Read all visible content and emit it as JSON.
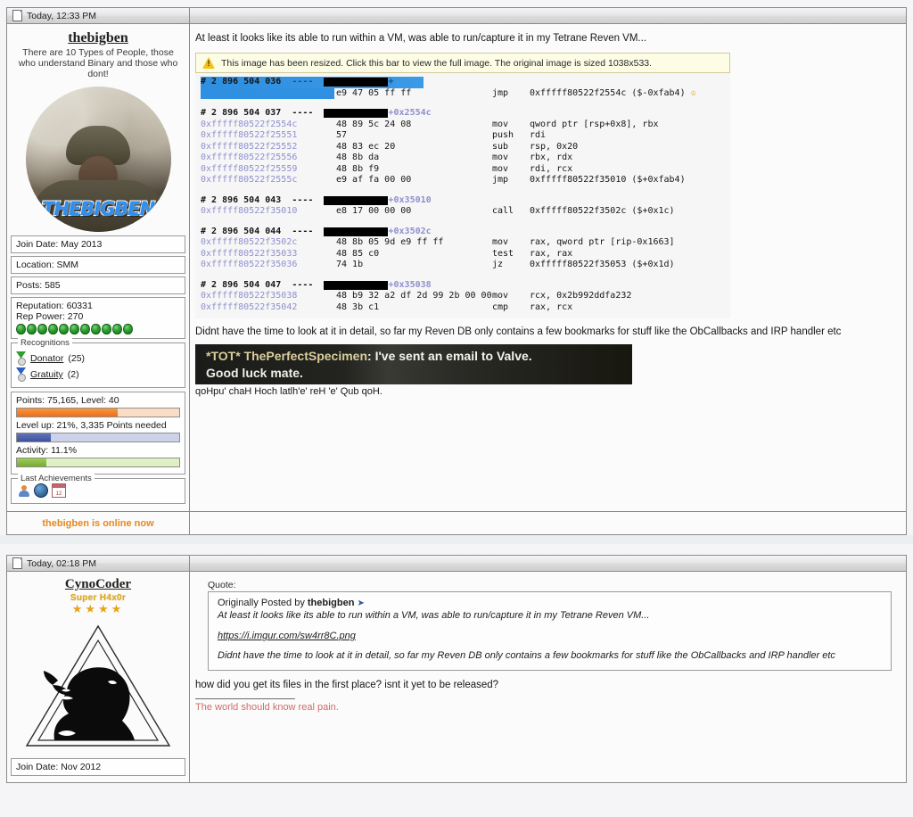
{
  "posts": [
    {
      "header": {
        "timestamp": "Today, 12:33 PM",
        "icon": "document-icon"
      },
      "user": {
        "name": "thebigben",
        "title": "There are 10 Types of People, those who understand Binary and those who dont!",
        "avatar_text": "THEBIGBEN",
        "join_date": "Join Date: May 2013",
        "location": "Location: SMM",
        "posts": "Posts: 585",
        "reputation": "Reputation: 60331",
        "rep_power": "Rep Power: 270",
        "rep_pips": 11,
        "recognitions_legend": "Recognitions",
        "recognitions": [
          {
            "label": "Donator",
            "count": "(25)",
            "color": "#2e9e2e"
          },
          {
            "label": "Gratuity",
            "count": "(2)",
            "color": "#2f5fc0"
          }
        ],
        "points": "Points: 75,165, Level: 40",
        "points_pct": 62,
        "levelup": "Level up: 21%, 3,335 Points needed",
        "levelup_pct": 21,
        "activity": "Activity: 11.1%",
        "activity_pct": 18,
        "achievements_legend": "Last Achievements",
        "achievement_icons": [
          "person-icon",
          "globe-icon",
          "calendar-icon"
        ],
        "online_status": "thebigben is online now"
      },
      "content": {
        "intro": "At least it looks like its able to run within a VM, was able to run/capture it in my Tetrane Reven VM...",
        "resize_notice": "This image has been resized. Click this bar to view the full image. The original image is sized 1038x533.",
        "outro": "Didnt have the time to look at it in detail, so far my Reven DB only contains a few bookmarks for stuff like the ObCallbacks and IRP handler etc",
        "video": {
          "nickname": "*TOT* ThePerfectSpecimen",
          "line1": ": I've sent an email to Valve.",
          "line2": "Good luck mate."
        },
        "klingon": "qoHpu' chaH Hoch latlh'e' reH 'e' Qub qoH."
      },
      "disassembly": [
        {
          "type": "group",
          "id": "# 2 896 504 036",
          "dashes": "----",
          "offset": "",
          "selected": true
        },
        {
          "type": "code",
          "addr": "",
          "bytes": "e9 47 05 ff ff",
          "mnemonic": "jmp",
          "operands": "0xfffff80522f2554c ($-0xfab4)",
          "crown": true
        },
        {
          "type": "blank"
        },
        {
          "type": "group",
          "id": "# 2 896 504 037",
          "dashes": "----",
          "offset": "+0x2554c"
        },
        {
          "type": "code",
          "addr": "0xfffff80522f2554c",
          "bytes": "48 89 5c 24 08",
          "mnemonic": "mov",
          "operands": "qword ptr [rsp+0x8], rbx"
        },
        {
          "type": "code",
          "addr": "0xfffff80522f25551",
          "bytes": "57",
          "mnemonic": "push",
          "operands": "rdi"
        },
        {
          "type": "code",
          "addr": "0xfffff80522f25552",
          "bytes": "48 83 ec 20",
          "mnemonic": "sub",
          "operands": "rsp, 0x20"
        },
        {
          "type": "code",
          "addr": "0xfffff80522f25556",
          "bytes": "48 8b da",
          "mnemonic": "mov",
          "operands": "rbx, rdx"
        },
        {
          "type": "code",
          "addr": "0xfffff80522f25559",
          "bytes": "48 8b f9",
          "mnemonic": "mov",
          "operands": "rdi, rcx"
        },
        {
          "type": "code",
          "addr": "0xfffff80522f2555c",
          "bytes": "e9 af fa 00 00",
          "mnemonic": "jmp",
          "operands": "0xfffff80522f35010 ($+0xfab4)"
        },
        {
          "type": "blank"
        },
        {
          "type": "group",
          "id": "# 2 896 504 043",
          "dashes": "----",
          "offset": "+0x35010"
        },
        {
          "type": "code",
          "addr": "0xfffff80522f35010",
          "bytes": "e8 17 00 00 00",
          "mnemonic": "call",
          "operands": "0xfffff80522f3502c ($+0x1c)"
        },
        {
          "type": "blank"
        },
        {
          "type": "group",
          "id": "# 2 896 504 044",
          "dashes": "----",
          "offset": "+0x3502c"
        },
        {
          "type": "code",
          "addr": "0xfffff80522f3502c",
          "bytes": "48 8b 05 9d e9 ff ff",
          "mnemonic": "mov",
          "operands": "rax, qword ptr [rip-0x1663]"
        },
        {
          "type": "code",
          "addr": "0xfffff80522f35033",
          "bytes": "48 85 c0",
          "mnemonic": "test",
          "operands": "rax, rax"
        },
        {
          "type": "code",
          "addr": "0xfffff80522f35036",
          "bytes": "74 1b",
          "mnemonic": "jz",
          "operands": "0xfffff80522f35053 ($+0x1d)"
        },
        {
          "type": "blank"
        },
        {
          "type": "group",
          "id": "# 2 896 504 047",
          "dashes": "----",
          "offset": "+0x35038"
        },
        {
          "type": "code",
          "addr": "0xfffff80522f35038",
          "bytes": "48 b9 32 a2 df 2d 99 2b 00 00",
          "mnemonic": "mov",
          "operands": "rcx, 0x2b992ddfa232"
        },
        {
          "type": "code",
          "addr": "0xfffff80522f35042",
          "bytes": "48 3b c1",
          "mnemonic": "cmp",
          "operands": "rax, rcx"
        }
      ]
    },
    {
      "header": {
        "timestamp": "Today, 02:18 PM",
        "icon": "document-icon"
      },
      "user": {
        "name": "CynoCoder",
        "rank": "Super H4x0r",
        "stars": 4,
        "join_date": "Join Date: Nov 2012"
      },
      "content": {
        "quote_label": "Quote:",
        "quote_author_prefix": "Originally Posted by",
        "quote_author": "thebigben",
        "quote_line1": "At least it looks like its able to run within a VM, was able to run/capture it in my Tetrane Reven VM...",
        "quote_link": "https://i.imgur.com/sw4rr8C.png",
        "quote_line2": "Didnt have the time to look at it in detail, so far my Reven DB only contains a few bookmarks for stuff like the ObCallbacks and IRP handler etc",
        "reply": "how did you get its files in the first place? isnt it yet to be released?",
        "signature": "The world should know real pain."
      }
    }
  ],
  "colors": {
    "selection_blue": "#2f8fe0",
    "address_purple": "#8f8fd0",
    "online_orange": "#e8871a",
    "signature_red": "#d06a6a",
    "rank_gold": "#e0a81c"
  }
}
